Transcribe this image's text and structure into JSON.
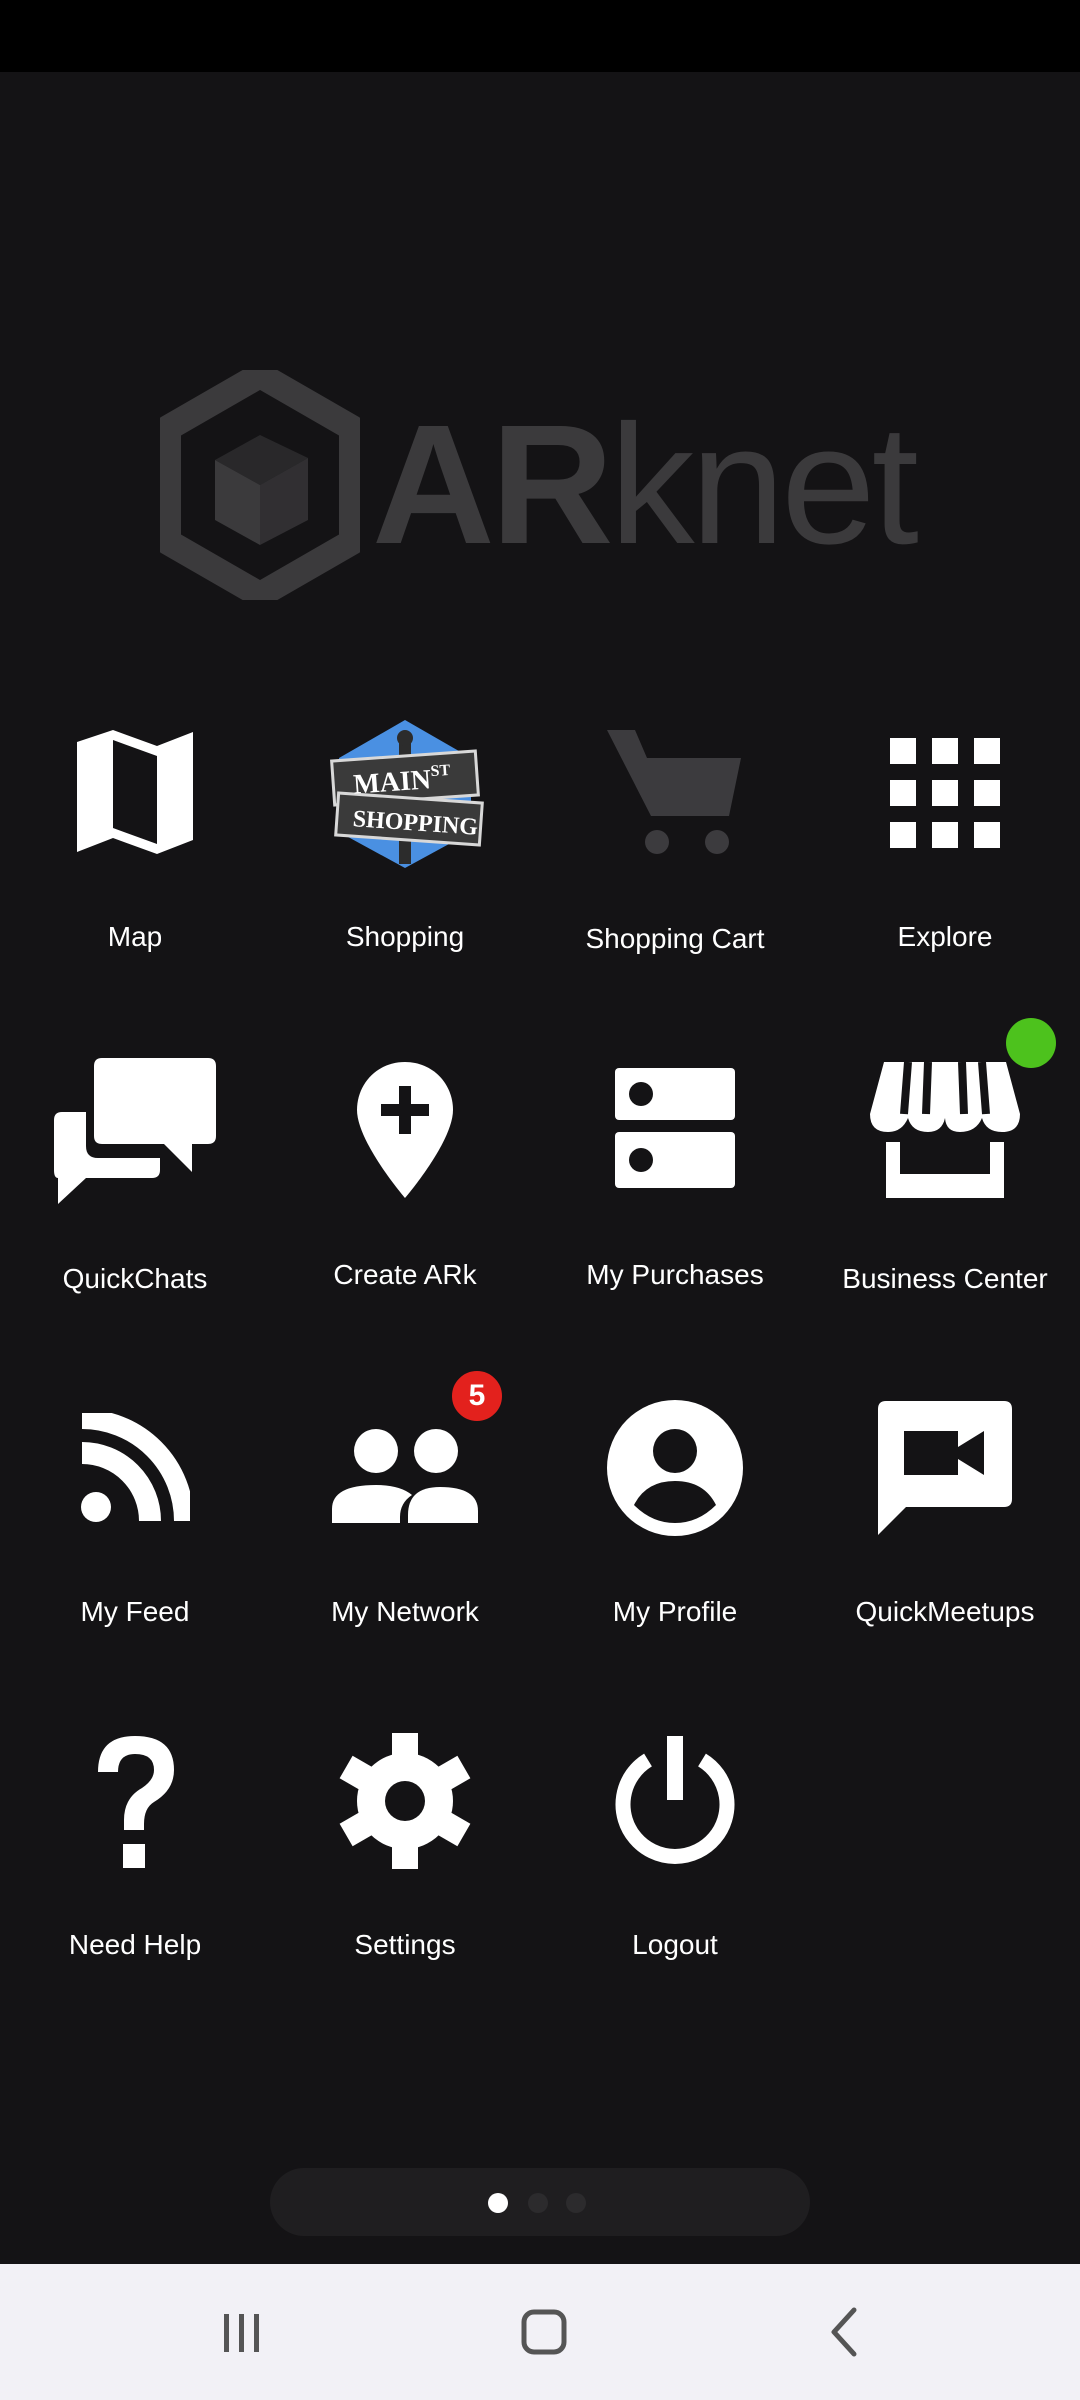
{
  "brand": {
    "name_bold": "AR",
    "name_light": "knet"
  },
  "menu": {
    "items": [
      {
        "label": "Map",
        "icon": "map-icon"
      },
      {
        "label": "Shopping",
        "icon": "main-st-shopping-sign-icon",
        "sign_line1": "MAIN",
        "sign_line1_sup": "ST",
        "sign_line2": "SHOPPING"
      },
      {
        "label": "Shopping Cart",
        "icon": "shopping-cart-icon"
      },
      {
        "label": "Explore",
        "icon": "grid-icon"
      },
      {
        "label": "QuickChats",
        "icon": "chat-bubbles-icon"
      },
      {
        "label": "Create ARk",
        "icon": "add-location-pin-icon"
      },
      {
        "label": "My Purchases",
        "icon": "storage-list-icon"
      },
      {
        "label": "Business Center",
        "icon": "storefront-icon",
        "status_dot_color": "#4dc21d"
      },
      {
        "label": "My Feed",
        "icon": "rss-feed-icon"
      },
      {
        "label": "My Network",
        "icon": "people-icon",
        "badge": "5"
      },
      {
        "label": "My Profile",
        "icon": "account-circle-icon"
      },
      {
        "label": "QuickMeetups",
        "icon": "video-chat-icon"
      },
      {
        "label": "Need Help",
        "icon": "question-mark-icon"
      },
      {
        "label": "Settings",
        "icon": "gear-icon"
      },
      {
        "label": "Logout",
        "icon": "power-icon"
      }
    ]
  },
  "pager": {
    "pages": 3,
    "current": 1
  },
  "colors": {
    "background": "#141315",
    "badge_red": "#e3211d",
    "online_green": "#4dc21d",
    "logo_gray": "#3b3a3c"
  },
  "navigation_bar": {
    "recents_icon": "recents-icon",
    "home_icon": "home-icon",
    "back_icon": "back-icon"
  }
}
